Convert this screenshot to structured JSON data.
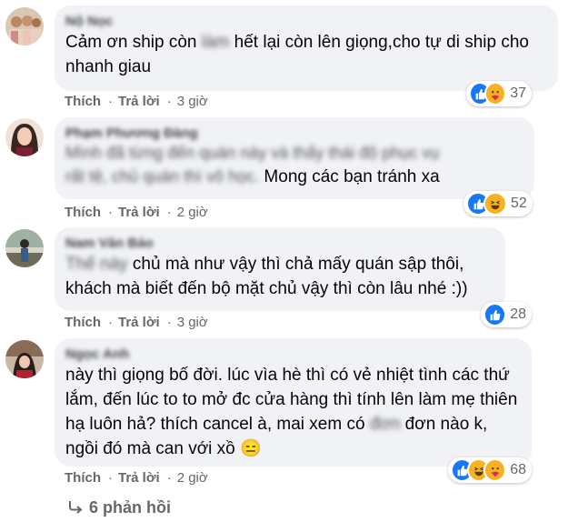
{
  "comments": [
    {
      "author": "Nộ Nọc",
      "text_blur_lead": "Cảm ơn ship còn ",
      "text_blur_word": "làm",
      "text_rest": " hết lại còn lên giọng,cho tự di ship cho nhanh giau",
      "like": "Thích",
      "reply": "Trả lời",
      "time": "3 giờ",
      "reactions": [
        "like",
        "care"
      ],
      "count": "37"
    },
    {
      "author": "Phạm Phương Đàng",
      "blur_line": "Mình đã từng đến quán này và thấy thái độ phục vụ",
      "blur_line2": "rất tệ, chủ quán thì vô học.",
      "text_rest": " Mong các bạn tránh xa",
      "like": "Thích",
      "reply": "Trả lời",
      "time": "2 giờ",
      "reactions": [
        "like",
        "haha"
      ],
      "count": "52"
    },
    {
      "author": "Nam Văn Bảo",
      "text_blur_lead": "Thế này",
      "text_rest": " chủ mà như vậy thì chả mấy quán sập thôi, khách mà biết đến bộ mặt chủ vậy thì còn lâu nhé :))",
      "like": "Thích",
      "reply": "Trả lời",
      "time": "3 giờ",
      "reactions": [
        "like"
      ],
      "count": "28"
    },
    {
      "author": "Ngọc Anh",
      "text_1": "này thì giọng bố đời. lúc vìa hè thì có vẻ nhiệt tình các thứ lắm, đến lúc to to mở đc cửa hàng thì tính lên làm mẹ thiên hạ luôn hả? thích cancel à, mai xem có ",
      "text_blur_word": "đơn",
      "text_2": " đơn nào k, ngồi đó mà can với xồ 😑",
      "like": "Thích",
      "reply": "Trả lời",
      "time": "2 giờ",
      "reactions": [
        "like",
        "haha",
        "care"
      ],
      "count": "68"
    }
  ],
  "replies_label": "6 phản hồi",
  "colors": {
    "bubble": "#f0f2f5",
    "meta": "#65676b",
    "like": "#1877f2",
    "emoji": "#f7b125"
  }
}
